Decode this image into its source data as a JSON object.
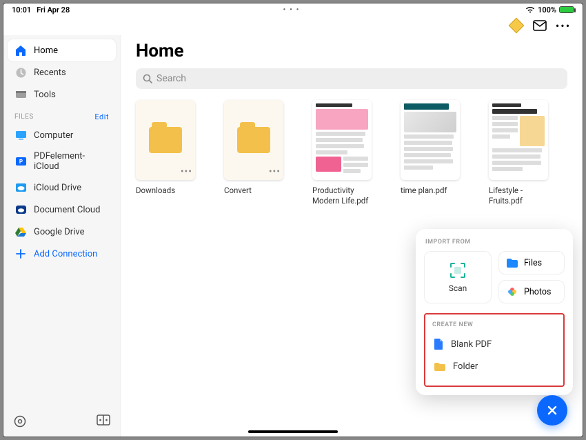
{
  "status": {
    "time": "10:01",
    "date": "Fri Apr 28",
    "battery_pct": "100%"
  },
  "page": {
    "title": "Home",
    "search_placeholder": "Search"
  },
  "sidebar": {
    "nav": [
      {
        "label": "Home"
      },
      {
        "label": "Recents"
      },
      {
        "label": "Tools"
      }
    ],
    "files_header": "FILES",
    "files_edit": "Edit",
    "locations": [
      {
        "label": "Computer"
      },
      {
        "label": "PDFelement-iCloud"
      },
      {
        "label": "iCloud Drive"
      },
      {
        "label": "Document Cloud"
      },
      {
        "label": "Google Drive"
      }
    ],
    "add_connection": "Add Connection"
  },
  "items": [
    {
      "label": "Downloads",
      "type": "folder"
    },
    {
      "label": "Convert",
      "type": "folder"
    },
    {
      "label": "Productivity Modern Life.pdf",
      "type": "doc",
      "variant": "pink"
    },
    {
      "label": "time plan.pdf",
      "type": "doc",
      "variant": "teal"
    },
    {
      "label": "Lifestyle - Fruits.pdf",
      "type": "doc",
      "variant": "yellow"
    }
  ],
  "popup": {
    "import_header": "IMPORT FROM",
    "scan_label": "Scan",
    "files_label": "Files",
    "photos_label": "Photos",
    "create_header": "CREATE NEW",
    "blank_pdf": "Blank PDF",
    "folder": "Folder"
  }
}
